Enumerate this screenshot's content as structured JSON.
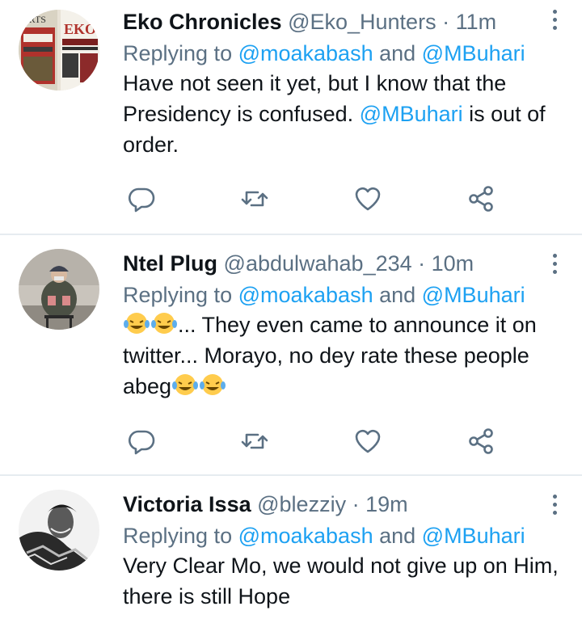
{
  "tweets": [
    {
      "name": "Eko Chronicles",
      "handle": "@Eko_Hunters",
      "time": "· 11m",
      "replying_prefix": "Replying to ",
      "replying_mention_1": "@moakabash",
      "replying_and": " and ",
      "replying_mention_2": "@MBuhari",
      "body_1": "Have not seen it yet, but I know that the Presidency is confused. ",
      "body_mention": "@MBuhari",
      "body_2": " is out of order."
    },
    {
      "name": "Ntel Plug",
      "handle": "@abdulwahab_234",
      "time": "· 10m",
      "replying_prefix": "Replying to ",
      "replying_mention_1": "@moakabash",
      "replying_and": " and ",
      "replying_mention_2": "@MBuhari",
      "body_1": "... They even came to announce it on twitter... Morayo, no dey rate these people abeg"
    },
    {
      "name": "Victoria Issa",
      "handle": "@blezziy",
      "time": "· 19m",
      "replying_prefix": "Replying to ",
      "replying_mention_1": "@moakabash",
      "replying_and": " and ",
      "replying_mention_2": "@MBuhari",
      "body_1": "Very Clear Mo, we would not give up on Him, there is still Hope"
    }
  ],
  "avatars": {
    "t1_newspaper_text": "EKO",
    "t1_newspaper_side": "ORTS"
  },
  "colors": {
    "link": "#1da1f2",
    "secondary": "#5b7083",
    "divider": "#e6ecf0",
    "text": "#0f1419"
  },
  "icons": [
    "reply-icon",
    "retweet-icon",
    "like-icon",
    "share-icon",
    "more-icon",
    "laughing-tears-emoji"
  ]
}
